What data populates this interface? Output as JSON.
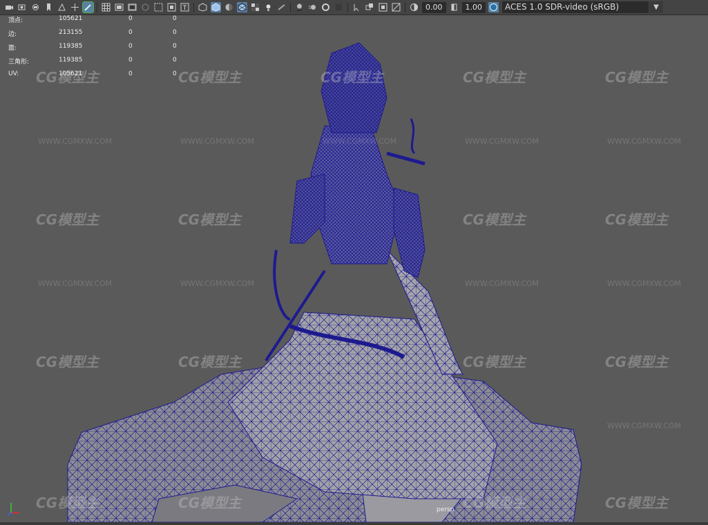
{
  "toolbar": {
    "exposure_value": "0.00",
    "gamma_value": "1.00",
    "color_space": "ACES 1.0 SDR-video (sRGB)",
    "icons": [
      "camera-icon",
      "camera-attributes-icon",
      "bookmark-icon",
      "image-plane-icon",
      "grid-icon",
      "film-gate-icon",
      "resolution-gate-icon",
      "gate-mask-icon",
      "field-chart-icon",
      "safe-action-icon",
      "safe-title-icon",
      "wireframe-icon",
      "smooth-shade-icon",
      "shade-wireframe-icon",
      "xray-icon",
      "lights-icon",
      "shadows-icon",
      "ambient-occlusion-icon",
      "motion-blur-icon",
      "aa-icon",
      "isolate-icon",
      "xray-joints-icon",
      "exposure-icon",
      "gamma-icon",
      "color-management-icon"
    ]
  },
  "hud": {
    "rows": [
      {
        "label": "顶点:",
        "value": "105621",
        "selected": "0",
        "components": "0"
      },
      {
        "label": "边:",
        "value": "213155",
        "selected": "0",
        "components": "0"
      },
      {
        "label": "面:",
        "value": "119385",
        "selected": "0",
        "components": "0"
      },
      {
        "label": "三角形:",
        "value": "119385",
        "selected": "0",
        "components": "0"
      },
      {
        "label": "UV:",
        "value": "105621",
        "selected": "0",
        "components": "0"
      }
    ]
  },
  "viewport": {
    "camera_label": "persp",
    "watermark_logo": "CG模型主",
    "watermark_url": "WWW.CGMXW.COM",
    "wire_color": "#1d1a8f",
    "background": "#5a5a5a"
  }
}
